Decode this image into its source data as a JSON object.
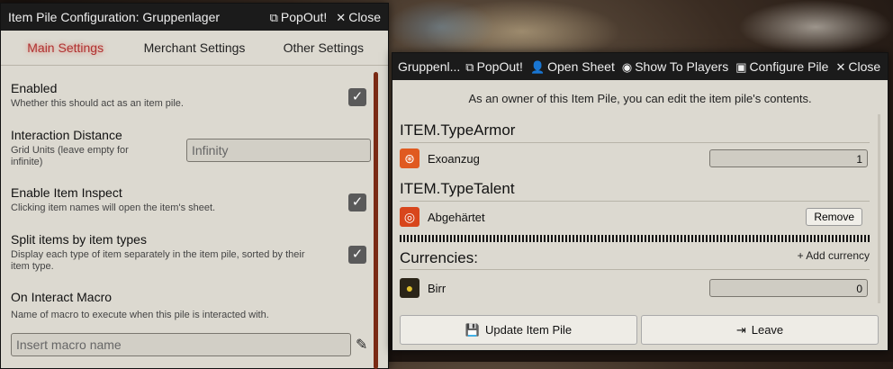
{
  "config_window": {
    "title": "Item Pile Configuration: Gruppenlager",
    "popout_label": "PopOut!",
    "close_label": "Close",
    "tabs": [
      "Main Settings",
      "Merchant Settings",
      "Other Settings"
    ],
    "settings": {
      "enabled": {
        "label": "Enabled",
        "hint": "Whether this should act as an item pile.",
        "checked": true
      },
      "interaction_distance": {
        "label": "Interaction Distance",
        "hint": "Grid Units (leave empty for infinite)",
        "placeholder": "Infinity"
      },
      "enable_inspect": {
        "label": "Enable Item Inspect",
        "hint": "Clicking item names will open the item's sheet.",
        "checked": true
      },
      "split_items": {
        "label": "Split items by item types",
        "hint": "Display each type of item separately in the item pile, sorted by their item type.",
        "checked": true
      },
      "interact_macro": {
        "label": "On Interact Macro",
        "hint": "Name of macro to execute when this pile is interacted with.",
        "placeholder": "Insert macro name"
      }
    }
  },
  "pile_window": {
    "title": "Gruppenl...",
    "buttons": {
      "popout": "PopOut!",
      "open_sheet": "Open Sheet",
      "show_players": "Show To Players",
      "configure": "Configure Pile",
      "close": "Close"
    },
    "owner_note": "As an owner of this Item Pile, you can edit the item pile's contents.",
    "sections": [
      {
        "header": "ITEM.TypeArmor",
        "items": [
          {
            "name": "Exoanzug",
            "quantity": "1",
            "icon": "armor-icon"
          }
        ]
      },
      {
        "header": "ITEM.TypeTalent",
        "items": [
          {
            "name": "Abgehärtet",
            "action": "Remove",
            "icon": "talent-icon"
          }
        ]
      }
    ],
    "currencies_header": "Currencies:",
    "add_currency": "Add currency",
    "currencies": [
      {
        "name": "Birr",
        "quantity": "0",
        "icon": "coin-icon"
      }
    ],
    "update_button": "Update Item Pile",
    "leave_button": "Leave"
  },
  "colors": {
    "active_tab": "#b03030",
    "titlebar": "#1b1b1b",
    "panel": "#dcd9d0",
    "scrollbar": "#7a2a14"
  }
}
